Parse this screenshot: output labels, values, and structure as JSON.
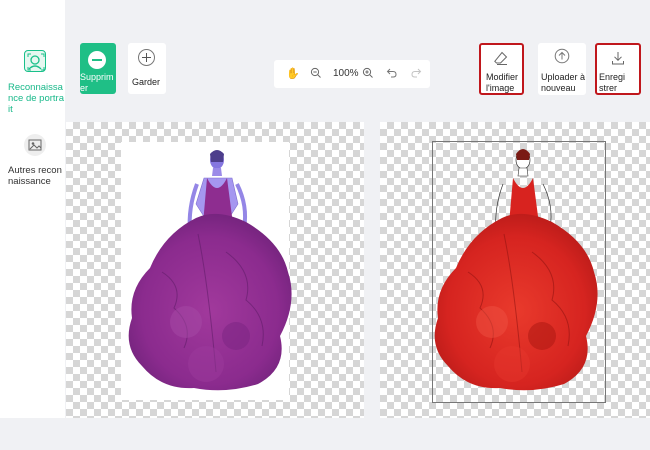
{
  "sidebar": {
    "items": [
      {
        "label": "Reconnaissance de portrait",
        "icon": "portrait-recognition-icon",
        "active": true
      },
      {
        "label": "Autres reconnaissance",
        "icon": "image-recognition-icon",
        "active": false
      }
    ]
  },
  "toolbar": {
    "delete_label": "Supprimer",
    "keep_label": "Garder",
    "zoom_label": "100%",
    "edit_label": "Modifier l'image",
    "upload_label": "Uploader à nouveau",
    "save_label": "Enregistrer"
  },
  "colors": {
    "accent": "#1fbf86",
    "highlight_border": "#c0171c",
    "dress_left": "#8a2f8c",
    "dress_right": "#d8231f"
  }
}
